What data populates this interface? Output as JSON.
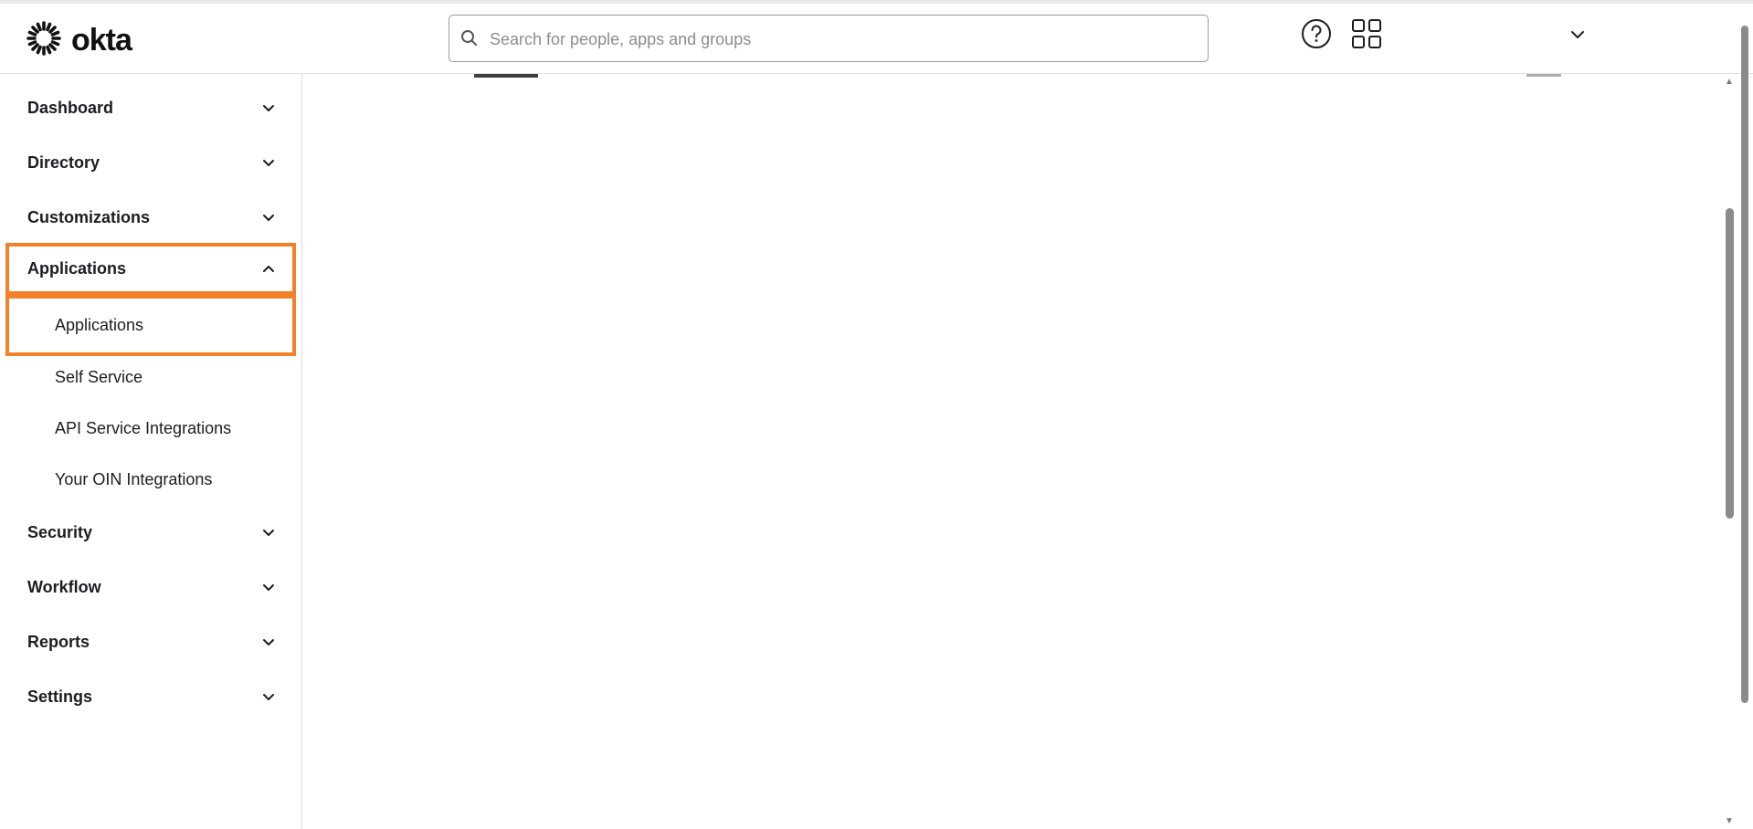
{
  "app": {
    "brand": "okta"
  },
  "search": {
    "placeholder": "Search for people, apps and groups",
    "value": ""
  },
  "icons": {
    "logo": "okta-sunburst-icon",
    "search": "search-icon",
    "help": "help-circle-icon",
    "apps_grid": "grid-icon",
    "user_menu": "chevron-down-icon"
  },
  "colors": {
    "highlight": "#f2822a",
    "text": "#1d1d21",
    "border": "#e1e1e6"
  },
  "sidebar": {
    "items": [
      {
        "label": "Dashboard",
        "expanded": false
      },
      {
        "label": "Directory",
        "expanded": false
      },
      {
        "label": "Customizations",
        "expanded": false
      },
      {
        "label": "Applications",
        "expanded": true,
        "children": [
          {
            "label": "Applications",
            "selected": true
          },
          {
            "label": "Self Service"
          },
          {
            "label": "API Service Integrations"
          },
          {
            "label": "Your OIN Integrations"
          }
        ]
      },
      {
        "label": "Security",
        "expanded": false
      },
      {
        "label": "Workflow",
        "expanded": false
      },
      {
        "label": "Reports",
        "expanded": false
      },
      {
        "label": "Settings",
        "expanded": false
      }
    ]
  }
}
